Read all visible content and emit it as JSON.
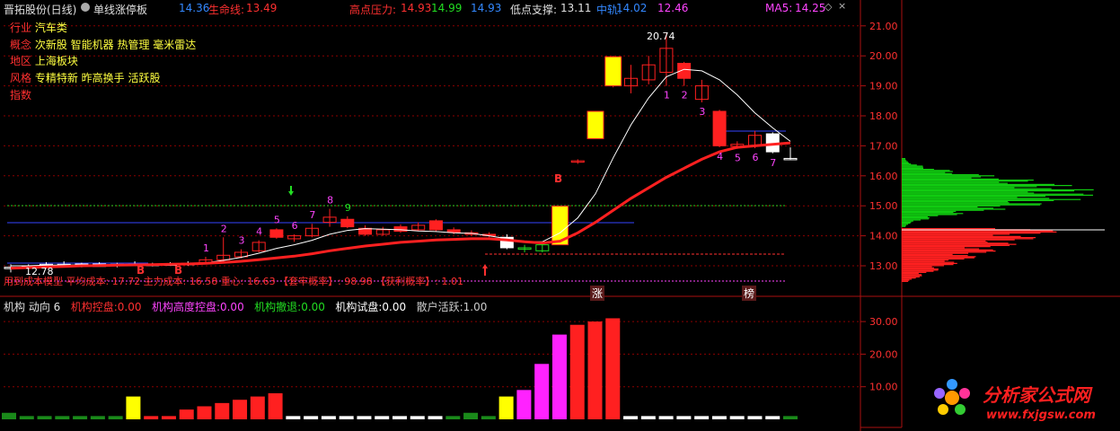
{
  "header": {
    "stock_name": "晋拓股份(日线)",
    "indicator_name": "单线涨停板",
    "price_a": "14.36",
    "life_line_label": "生命线:",
    "life_line_value": "13.49",
    "high_pressure_label": "高点压力:",
    "high_pressure_1": "14.93",
    "high_pressure_2": "14.99",
    "high_pressure_3": "14.93",
    "low_support_label": "低点支撑:",
    "low_support_value": "13.11",
    "mid_label": "中轨:",
    "mid_value": "14.02",
    "mid_value_2": "12.46",
    "ma5_label": "MA5:",
    "ma5_value": "14.25"
  },
  "info_panel": [
    {
      "key": "行业",
      "value": "汽车类"
    },
    {
      "key": "概念",
      "value": "次新股 智能机器 热管理 毫米雷达"
    },
    {
      "key": "地区",
      "value": "上海板块"
    },
    {
      "key": "风格",
      "value": "专精特新 昨高换手 活跃股"
    },
    {
      "key": "指数",
      "value": ""
    }
  ],
  "cost_line": {
    "text": "用到成本模型 平均成本: 17.72  主力成本: 16.58  重心: 16.63 【套牢概率】: 98.98 【获利概率】: 1.01"
  },
  "upper_axis_ticks": [
    "21.00",
    "20.00",
    "19.00",
    "18.00",
    "17.00",
    "16.00",
    "15.00",
    "14.00",
    "13.00"
  ],
  "lower_axis_ticks": [
    "30.00",
    "20.00",
    "10.00"
  ],
  "lower_header": {
    "title": "机构 动向 6",
    "items": [
      {
        "label": "机构控盘:",
        "value": "0.00",
        "color": "#ff3030"
      },
      {
        "label": "机构高度控盘:",
        "value": "0.00",
        "color": "#ff44ff"
      },
      {
        "label": "机构撤退:",
        "value": "0.00",
        "color": "#22dd22"
      },
      {
        "label": "机构试盘:",
        "value": "0.00",
        "color": "#ffffff"
      },
      {
        "label": "散户活跃:",
        "value": "1.00",
        "color": "#cccccc"
      }
    ]
  },
  "annotations": {
    "high_label": "20.74",
    "low_label": "12.78",
    "limit_up_marker": "涨",
    "list_marker": "榜",
    "buy_marker": "B"
  },
  "logo": {
    "brand": "分析家公式网",
    "url": "www.fxjgsw.com"
  },
  "colors": {
    "up": "#ff2020",
    "down": "#ffffff",
    "limit": "#ffff00",
    "ma5": "#ffffff",
    "life_line": "#ff2020",
    "grid": "#8b0000"
  },
  "chart_data": [
    {
      "type": "candlestick",
      "title": "单线涨停板",
      "ylim": [
        12.3,
        21.5
      ],
      "y_ticks": [
        13,
        14,
        15,
        16,
        17,
        18,
        19,
        20,
        21
      ],
      "candles": [
        {
          "o": 12.95,
          "h": 13.05,
          "l": 12.78,
          "c": 12.92,
          "cls": "w"
        },
        {
          "o": 12.95,
          "h": 13.05,
          "l": 12.9,
          "c": 12.98,
          "cls": "w"
        },
        {
          "o": 13.0,
          "h": 13.12,
          "l": 12.95,
          "c": 13.05,
          "cls": "w"
        },
        {
          "o": 13.05,
          "h": 13.15,
          "l": 12.98,
          "c": 13.0,
          "cls": "w"
        },
        {
          "o": 13.02,
          "h": 13.1,
          "l": 12.95,
          "c": 13.06,
          "cls": "w"
        },
        {
          "o": 13.06,
          "h": 13.12,
          "l": 12.98,
          "c": 12.98,
          "cls": "W"
        },
        {
          "o": 13.0,
          "h": 13.1,
          "l": 12.95,
          "c": 13.05,
          "cls": "w"
        },
        {
          "o": 13.05,
          "h": 13.15,
          "l": 13.0,
          "c": 13.02,
          "cls": "w"
        },
        {
          "o": 13.02,
          "h": 13.1,
          "l": 12.98,
          "c": 13.05,
          "cls": "w"
        },
        {
          "o": 13.05,
          "h": 13.12,
          "l": 13.0,
          "c": 13.06,
          "cls": "w"
        },
        {
          "o": 13.06,
          "h": 13.15,
          "l": 13.0,
          "c": 13.08,
          "cls": "w"
        },
        {
          "o": 13.08,
          "h": 13.3,
          "l": 13.05,
          "c": 13.2,
          "cls": "r"
        },
        {
          "o": 13.2,
          "h": 13.95,
          "l": 13.15,
          "c": 13.35,
          "cls": "r"
        },
        {
          "o": 13.3,
          "h": 13.55,
          "l": 13.25,
          "c": 13.45,
          "cls": "r"
        },
        {
          "o": 13.5,
          "h": 13.85,
          "l": 13.45,
          "c": 13.78,
          "cls": "r"
        },
        {
          "o": 13.95,
          "h": 14.25,
          "l": 13.9,
          "c": 14.2,
          "cls": "R"
        },
        {
          "o": 13.9,
          "h": 14.05,
          "l": 13.8,
          "c": 14.0,
          "cls": "r"
        },
        {
          "o": 14.0,
          "h": 14.4,
          "l": 13.95,
          "c": 14.25,
          "cls": "r"
        },
        {
          "o": 14.45,
          "h": 14.9,
          "l": 14.3,
          "c": 14.62,
          "cls": "r"
        },
        {
          "o": 14.55,
          "h": 14.65,
          "l": 14.25,
          "c": 14.3,
          "cls": "R"
        },
        {
          "o": 14.25,
          "h": 14.35,
          "l": 14.0,
          "c": 14.05,
          "cls": "R"
        },
        {
          "o": 14.05,
          "h": 14.3,
          "l": 14.0,
          "c": 14.2,
          "cls": "r"
        },
        {
          "o": 14.3,
          "h": 14.38,
          "l": 14.1,
          "c": 14.15,
          "cls": "R"
        },
        {
          "o": 14.2,
          "h": 14.45,
          "l": 14.15,
          "c": 14.35,
          "cls": "r"
        },
        {
          "o": 14.5,
          "h": 14.55,
          "l": 14.15,
          "c": 14.2,
          "cls": "R"
        },
        {
          "o": 14.2,
          "h": 14.28,
          "l": 14.05,
          "c": 14.12,
          "cls": "R"
        },
        {
          "o": 14.1,
          "h": 14.18,
          "l": 14.0,
          "c": 14.05,
          "cls": "R"
        },
        {
          "o": 14.05,
          "h": 14.12,
          "l": 13.95,
          "c": 14.0,
          "cls": "R"
        },
        {
          "o": 13.95,
          "h": 14.05,
          "l": 13.55,
          "c": 13.6,
          "cls": "W"
        },
        {
          "o": 13.55,
          "h": 13.7,
          "l": 13.45,
          "c": 13.6,
          "cls": "g"
        },
        {
          "o": 13.5,
          "h": 13.75,
          "l": 13.45,
          "c": 13.7,
          "cls": "g"
        },
        {
          "o": 13.7,
          "h": 15.0,
          "l": 13.7,
          "c": 14.99,
          "cls": "Y"
        },
        {
          "o": 16.5,
          "h": 16.55,
          "l": 16.4,
          "c": 16.48,
          "cls": "r"
        },
        {
          "o": 17.24,
          "h": 18.15,
          "l": 17.24,
          "c": 18.15,
          "cls": "Y"
        },
        {
          "o": 19.0,
          "h": 20.0,
          "l": 18.95,
          "c": 19.97,
          "cls": "Y"
        },
        {
          "o": 19.0,
          "h": 19.7,
          "l": 18.75,
          "c": 19.25,
          "cls": "r"
        },
        {
          "o": 19.2,
          "h": 20.0,
          "l": 19.05,
          "c": 19.7,
          "cls": "r"
        },
        {
          "o": 19.45,
          "h": 20.74,
          "l": 19.0,
          "c": 20.25,
          "cls": "r"
        },
        {
          "o": 19.75,
          "h": 19.8,
          "l": 19.0,
          "c": 19.25,
          "cls": "R"
        },
        {
          "o": 19.0,
          "h": 19.2,
          "l": 18.45,
          "c": 18.55,
          "cls": "r"
        },
        {
          "o": 18.15,
          "h": 18.2,
          "l": 16.95,
          "c": 17.0,
          "cls": "R"
        },
        {
          "o": 17.05,
          "h": 17.15,
          "l": 16.9,
          "c": 16.98,
          "cls": "r"
        },
        {
          "o": 17.0,
          "h": 17.5,
          "l": 16.92,
          "c": 17.35,
          "cls": "r"
        },
        {
          "o": 17.4,
          "h": 17.45,
          "l": 16.75,
          "c": 16.8,
          "cls": "W"
        },
        {
          "o": 16.55,
          "h": 16.95,
          "l": 16.55,
          "c": 16.58,
          "cls": "w"
        }
      ],
      "volume_bars": [
        {
          "v": 2,
          "c": "g"
        },
        {
          "v": 1,
          "c": "g"
        },
        {
          "v": 1,
          "c": "g"
        },
        {
          "v": 1,
          "c": "g"
        },
        {
          "v": 1,
          "c": "g"
        },
        {
          "v": 1,
          "c": "g"
        },
        {
          "v": 1,
          "c": "g"
        },
        {
          "v": 7,
          "c": "Y"
        },
        {
          "v": 1,
          "c": "r"
        },
        {
          "v": 1,
          "c": "r"
        },
        {
          "v": 3,
          "c": "r"
        },
        {
          "v": 4,
          "c": "r"
        },
        {
          "v": 5,
          "c": "r"
        },
        {
          "v": 6,
          "c": "r"
        },
        {
          "v": 7,
          "c": "r"
        },
        {
          "v": 8,
          "c": "r"
        },
        {
          "v": 1,
          "c": "w"
        },
        {
          "v": 1,
          "c": "w"
        },
        {
          "v": 1,
          "c": "w"
        },
        {
          "v": 1,
          "c": "w"
        },
        {
          "v": 1,
          "c": "w"
        },
        {
          "v": 1,
          "c": "w"
        },
        {
          "v": 1,
          "c": "w"
        },
        {
          "v": 1,
          "c": "w"
        },
        {
          "v": 1,
          "c": "w"
        },
        {
          "v": 1,
          "c": "g"
        },
        {
          "v": 2,
          "c": "g"
        },
        {
          "v": 1,
          "c": "g"
        },
        {
          "v": 7,
          "c": "Y"
        },
        {
          "v": 9,
          "c": "m"
        },
        {
          "v": 17,
          "c": "m"
        },
        {
          "v": 26,
          "c": "m"
        },
        {
          "v": 29,
          "c": "r"
        },
        {
          "v": 30,
          "c": "r"
        },
        {
          "v": 31,
          "c": "r"
        },
        {
          "v": 1,
          "c": "w"
        },
        {
          "v": 1,
          "c": "w"
        },
        {
          "v": 1,
          "c": "w"
        },
        {
          "v": 1,
          "c": "w"
        },
        {
          "v": 1,
          "c": "w"
        },
        {
          "v": 1,
          "c": "w"
        },
        {
          "v": 1,
          "c": "w"
        },
        {
          "v": 1,
          "c": "w"
        },
        {
          "v": 1,
          "c": "w"
        },
        {
          "v": 1,
          "c": "g"
        }
      ],
      "ma5": [
        13.0,
        13.0,
        13.02,
        13.02,
        13.03,
        13.02,
        13.03,
        13.03,
        13.03,
        13.04,
        13.05,
        13.1,
        13.18,
        13.28,
        13.42,
        13.58,
        13.7,
        13.85,
        14.05,
        14.18,
        14.24,
        14.22,
        14.2,
        14.16,
        14.14,
        14.1,
        14.08,
        14.0,
        13.9,
        13.8,
        13.8,
        14.1,
        14.6,
        15.4,
        16.6,
        17.7,
        18.6,
        19.3,
        19.55,
        19.5,
        19.2,
        18.7,
        18.1,
        17.6,
        17.15
      ],
      "life_line": [
        12.92,
        12.94,
        12.96,
        12.98,
        13.0,
        13.01,
        13.02,
        13.03,
        13.04,
        13.05,
        13.06,
        13.08,
        13.11,
        13.15,
        13.2,
        13.26,
        13.32,
        13.4,
        13.5,
        13.58,
        13.66,
        13.72,
        13.78,
        13.82,
        13.86,
        13.88,
        13.9,
        13.9,
        13.86,
        13.8,
        13.76,
        13.82,
        14.1,
        14.45,
        14.85,
        15.25,
        15.6,
        15.95,
        16.25,
        16.55,
        16.8,
        16.95,
        17.0,
        17.05,
        17.1
      ],
      "chip_distribution_green_max": 1.0,
      "chip_distribution_red_max": 0.9
    }
  ]
}
